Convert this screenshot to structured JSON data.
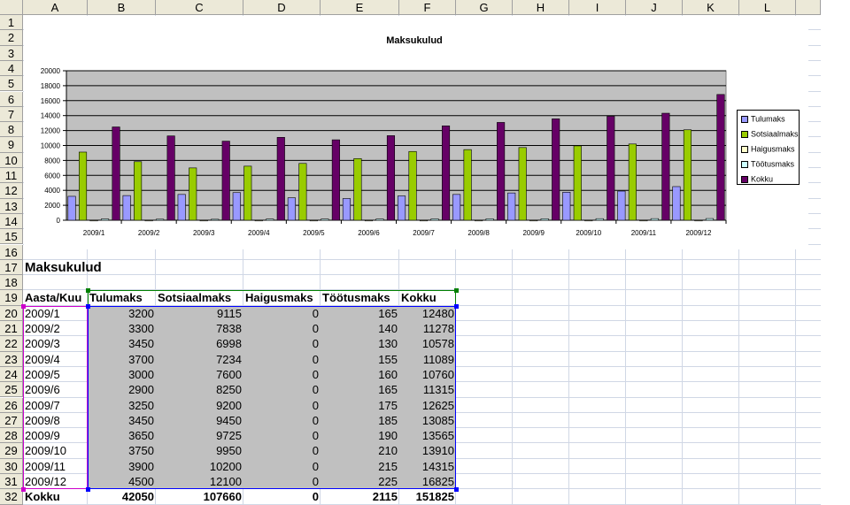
{
  "columns": [
    "A",
    "B",
    "C",
    "D",
    "E",
    "F",
    "G",
    "H",
    "I",
    "J",
    "K",
    "L"
  ],
  "rows": [
    "1",
    "2",
    "3",
    "4",
    "5",
    "6",
    "7",
    "8",
    "9",
    "10",
    "11",
    "12",
    "13",
    "14",
    "15",
    "16",
    "17",
    "18",
    "19",
    "20",
    "21",
    "22",
    "23",
    "24",
    "25",
    "26",
    "27",
    "28",
    "29",
    "30",
    "31",
    "32"
  ],
  "section_title": "Maksukulud",
  "table": {
    "headers": [
      "Aasta/Kuu",
      "Tulumaks",
      "Sotsiaalmaks",
      "Haigusmaks",
      "Töötusmaks",
      "Kokku"
    ],
    "rows": [
      [
        "2009/1",
        "3200",
        "9115",
        "0",
        "165",
        "12480"
      ],
      [
        "2009/2",
        "3300",
        "7838",
        "0",
        "140",
        "11278"
      ],
      [
        "2009/3",
        "3450",
        "6998",
        "0",
        "130",
        "10578"
      ],
      [
        "2009/4",
        "3700",
        "7234",
        "0",
        "155",
        "11089"
      ],
      [
        "2009/5",
        "3000",
        "7600",
        "0",
        "160",
        "10760"
      ],
      [
        "2009/6",
        "2900",
        "8250",
        "0",
        "165",
        "11315"
      ],
      [
        "2009/7",
        "3250",
        "9200",
        "0",
        "175",
        "12625"
      ],
      [
        "2009/8",
        "3450",
        "9450",
        "0",
        "185",
        "13085"
      ],
      [
        "2009/9",
        "3650",
        "9725",
        "0",
        "190",
        "13565"
      ],
      [
        "2009/10",
        "3750",
        "9950",
        "0",
        "210",
        "13910"
      ],
      [
        "2009/11",
        "3900",
        "10200",
        "0",
        "215",
        "14315"
      ],
      [
        "2009/12",
        "4500",
        "12100",
        "0",
        "225",
        "16825"
      ]
    ],
    "total": [
      "Kokku",
      "42050",
      "107660",
      "0",
      "2115",
      "151825"
    ]
  },
  "chart_data": {
    "type": "bar",
    "title": "Maksukulud",
    "categories": [
      "2009/1",
      "2009/2",
      "2009/3",
      "2009/4",
      "2009/5",
      "2009/6",
      "2009/7",
      "2009/8",
      "2009/9",
      "2009/10",
      "2009/11",
      "2009/12"
    ],
    "series": [
      {
        "name": "Tulumaks",
        "color": "#9999ff",
        "values": [
          3200,
          3300,
          3450,
          3700,
          3000,
          2900,
          3250,
          3450,
          3650,
          3750,
          3900,
          4500
        ]
      },
      {
        "name": "Sotsiaalmaks",
        "color": "#99cc00",
        "values": [
          9115,
          7838,
          6998,
          7234,
          7600,
          8250,
          9200,
          9450,
          9725,
          9950,
          10200,
          12100
        ]
      },
      {
        "name": "Haigusmaks",
        "color": "#ffffcc",
        "values": [
          0,
          0,
          0,
          0,
          0,
          0,
          0,
          0,
          0,
          0,
          0,
          0
        ]
      },
      {
        "name": "Töötusmaks",
        "color": "#ccffff",
        "values": [
          165,
          140,
          130,
          155,
          160,
          165,
          175,
          185,
          190,
          210,
          215,
          225
        ]
      },
      {
        "name": "Kokku",
        "color": "#660066",
        "values": [
          12480,
          11278,
          10578,
          11089,
          10760,
          11315,
          12625,
          13085,
          13565,
          13910,
          14315,
          16825
        ]
      }
    ],
    "yticks": [
      "0",
      "2000",
      "4000",
      "6000",
      "8000",
      "10000",
      "12000",
      "14000",
      "16000",
      "18000",
      "20000"
    ],
    "ylim": [
      0,
      20000
    ],
    "grid": true,
    "legend": "right"
  }
}
